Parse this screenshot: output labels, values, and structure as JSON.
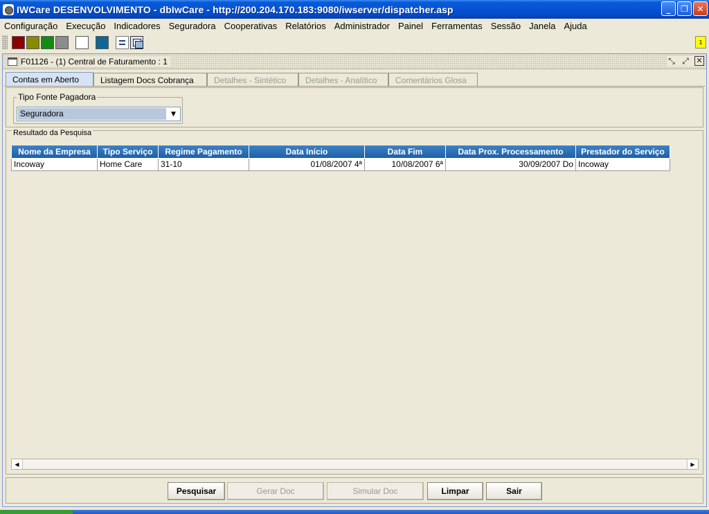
{
  "window": {
    "title": "IWCare DESENVOLVIMENTO - dbIwCare - http://200.204.170.183:9080/iwserver/dispatcher.asp"
  },
  "menu": [
    "Configuração",
    "Execução",
    "Indicadores",
    "Seguradora",
    "Cooperativas",
    "Relatórios",
    "Administrador",
    "Painel",
    "Ferramentas",
    "Sessão",
    "Janela",
    "Ajuda"
  ],
  "toolbar": {
    "swatch_colors": [
      "#8b0000",
      "#8a8a00",
      "#138a13",
      "#8c8c8c",
      "#ffffff",
      "#0f6795"
    ],
    "notification_count": "1"
  },
  "frame": {
    "title": "F01126 - (1) Central de Faturamento : 1"
  },
  "tabs": [
    {
      "label": "Contas em Aberto",
      "state": "active"
    },
    {
      "label": "Listagem Docs Cobrança",
      "state": "enabled"
    },
    {
      "label": "Detalhes - Sintético",
      "state": "disabled"
    },
    {
      "label": "Detalhes - Analítico",
      "state": "disabled"
    },
    {
      "label": "Comentários Glosa",
      "state": "disabled"
    }
  ],
  "filter": {
    "legend": "Tipo Fonte Pagadora",
    "selected": "Seguradora"
  },
  "results": {
    "legend": "Resultado da Pesquisa",
    "columns": [
      "Nome da Empresa",
      "Tipo Serviço",
      "Regime Pagamento",
      "Data Início",
      "Data Fim",
      "Data Prox. Processamento",
      "Prestador do Serviço"
    ],
    "rows": [
      [
        "Incoway",
        "Home Care",
        "31-10",
        "01/08/2007 4ª",
        "10/08/2007 6ª",
        "30/09/2007 Do",
        "Incoway"
      ]
    ]
  },
  "buttons": {
    "search": "Pesquisar",
    "generate": "Gerar Doc",
    "simulate": "Simular Doc",
    "clear": "Limpar",
    "exit": "Sair"
  }
}
